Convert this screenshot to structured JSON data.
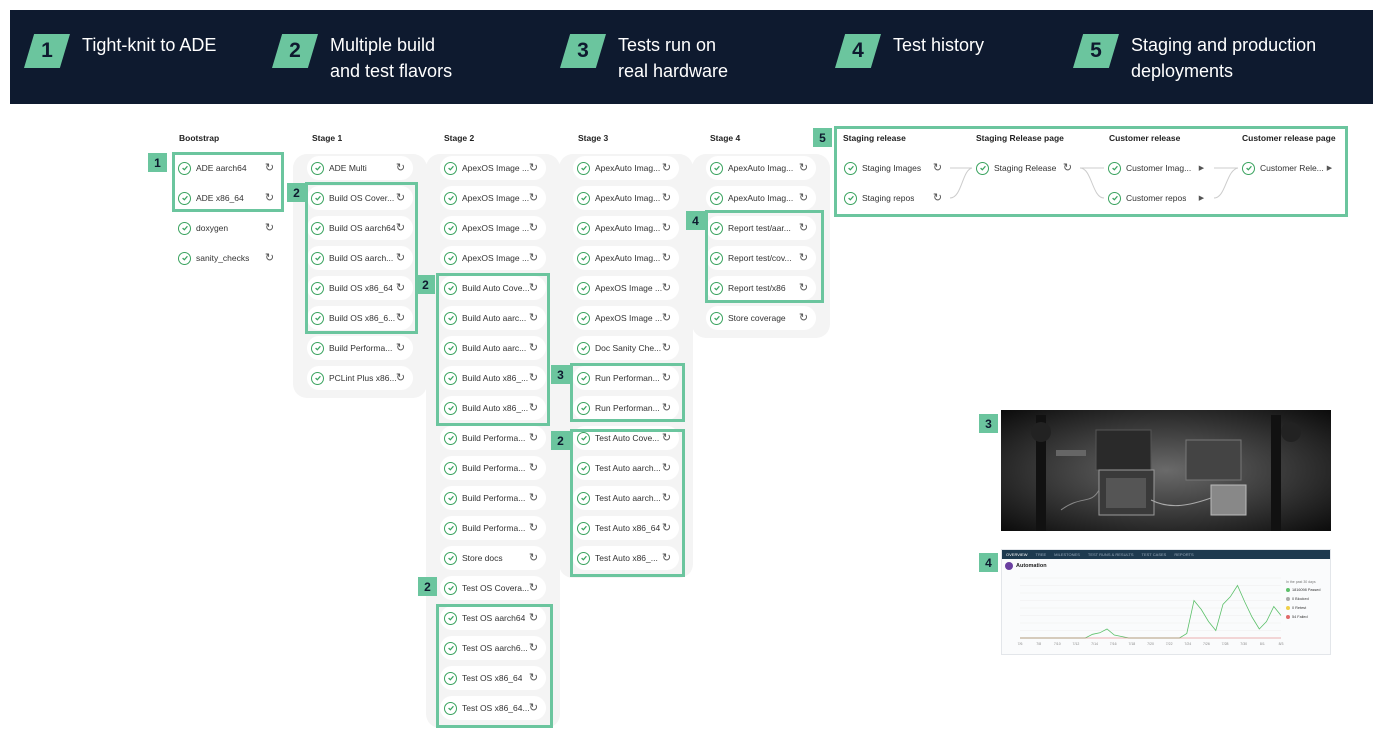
{
  "header": {
    "items": [
      {
        "num": "1",
        "text": "Tight-knit to ADE"
      },
      {
        "num": "2",
        "text": "Multiple build and test flavors"
      },
      {
        "num": "3",
        "text": "Tests run on real hardware"
      },
      {
        "num": "4",
        "text": "Test history"
      },
      {
        "num": "5",
        "text": "Staging and production deployments"
      }
    ]
  },
  "columns": {
    "bootstrap": {
      "title": "Bootstrap",
      "nodes": [
        "ADE aarch64",
        "ADE x86_64",
        "doxygen",
        "sanity_checks"
      ]
    },
    "stage1": {
      "title": "Stage 1",
      "nodes": [
        "ADE Multi",
        "Build OS Cover...",
        "Build OS aarch64",
        "Build OS aarch...",
        "Build OS x86_64",
        "Build OS x86_6...",
        "Build Performa...",
        "PCLint Plus x86..."
      ]
    },
    "stage2": {
      "title": "Stage 2",
      "nodes": [
        "ApexOS Image ...",
        "ApexOS Image ...",
        "ApexOS Image ...",
        "ApexOS Image ...",
        "Build Auto Cove...",
        "Build Auto aarc...",
        "Build Auto aarc...",
        "Build Auto x86_...",
        "Build Auto x86_...",
        "Build Performa...",
        "Build Performa...",
        "Build Performa...",
        "Build Performa...",
        "Store docs",
        "Test OS Covera...",
        "Test OS aarch64",
        "Test OS aarch6...",
        "Test OS x86_64",
        "Test OS x86_64..."
      ]
    },
    "stage3": {
      "title": "Stage 3",
      "nodes": [
        "ApexAuto Imag...",
        "ApexAuto Imag...",
        "ApexAuto Imag...",
        "ApexAuto Imag...",
        "ApexOS Image ...",
        "ApexOS Image ...",
        "Doc Sanity Che...",
        "Run Performan...",
        "Run Performan...",
        "Test Auto Cove...",
        "Test Auto aarch...",
        "Test Auto aarch...",
        "Test Auto x86_64",
        "Test Auto x86_..."
      ]
    },
    "stage4": {
      "title": "Stage 4",
      "nodes": [
        "ApexAuto Imag...",
        "ApexAuto Imag...",
        "Report test/aar...",
        "Report test/cov...",
        "Report test/x86",
        "Store coverage"
      ]
    },
    "staging_release": {
      "title": "Staging release",
      "nodes": [
        "Staging Images",
        "Staging repos"
      ]
    },
    "staging_release_page": {
      "title": "Staging Release page",
      "nodes": [
        "Staging Release"
      ]
    },
    "customer_release": {
      "title": "Customer release",
      "nodes": [
        "Customer Imag...",
        "Customer repos"
      ]
    },
    "customer_release_page": {
      "title": "Customer release page",
      "nodes": [
        "Customer Rele..."
      ]
    }
  },
  "tags": {
    "t1": "1",
    "t2a": "2",
    "t2b": "2",
    "t2c": "2",
    "t2d": "2",
    "t3a": "3",
    "t3b": "3",
    "t4a": "4",
    "t4b": "4",
    "t5": "5"
  },
  "dashboard": {
    "tabs": [
      "OVERVIEW",
      "TREE",
      "MILESTONES",
      "TEST RUNS & RESULTS",
      "TEST CASES",
      "REPORTS"
    ],
    "title": "Automation",
    "legend_hint": "In the past 30 days",
    "legend": [
      {
        "label": "1816098 Passed",
        "color": "#5cc06a"
      },
      {
        "label": "0 Blocked",
        "color": "#aaaaaa"
      },
      {
        "label": "0 Retest",
        "color": "#f0d04a"
      },
      {
        "label": "54 Failed",
        "color": "#e06a6a"
      }
    ],
    "x_ticks": [
      "7/6",
      "7/8",
      "7/10",
      "7/12",
      "7/14",
      "7/16",
      "7/18",
      "7/20",
      "7/22",
      "7/24",
      "7/26",
      "7/28",
      "7/30",
      "8/1",
      "8/3"
    ],
    "passed_series": [
      0,
      0,
      0,
      0,
      0,
      0,
      0,
      0,
      0,
      0,
      5000,
      7000,
      12000,
      4000,
      2000,
      0,
      0,
      0,
      0,
      0,
      0,
      0,
      0,
      6000,
      50000,
      38000,
      22000,
      10000,
      45000,
      55000,
      70000,
      48000,
      28000,
      12000,
      22000,
      42000,
      30000
    ]
  },
  "colors": {
    "accent": "#6bc59e",
    "header_bg": "#0e1a2f",
    "check": "#3aa35f"
  }
}
